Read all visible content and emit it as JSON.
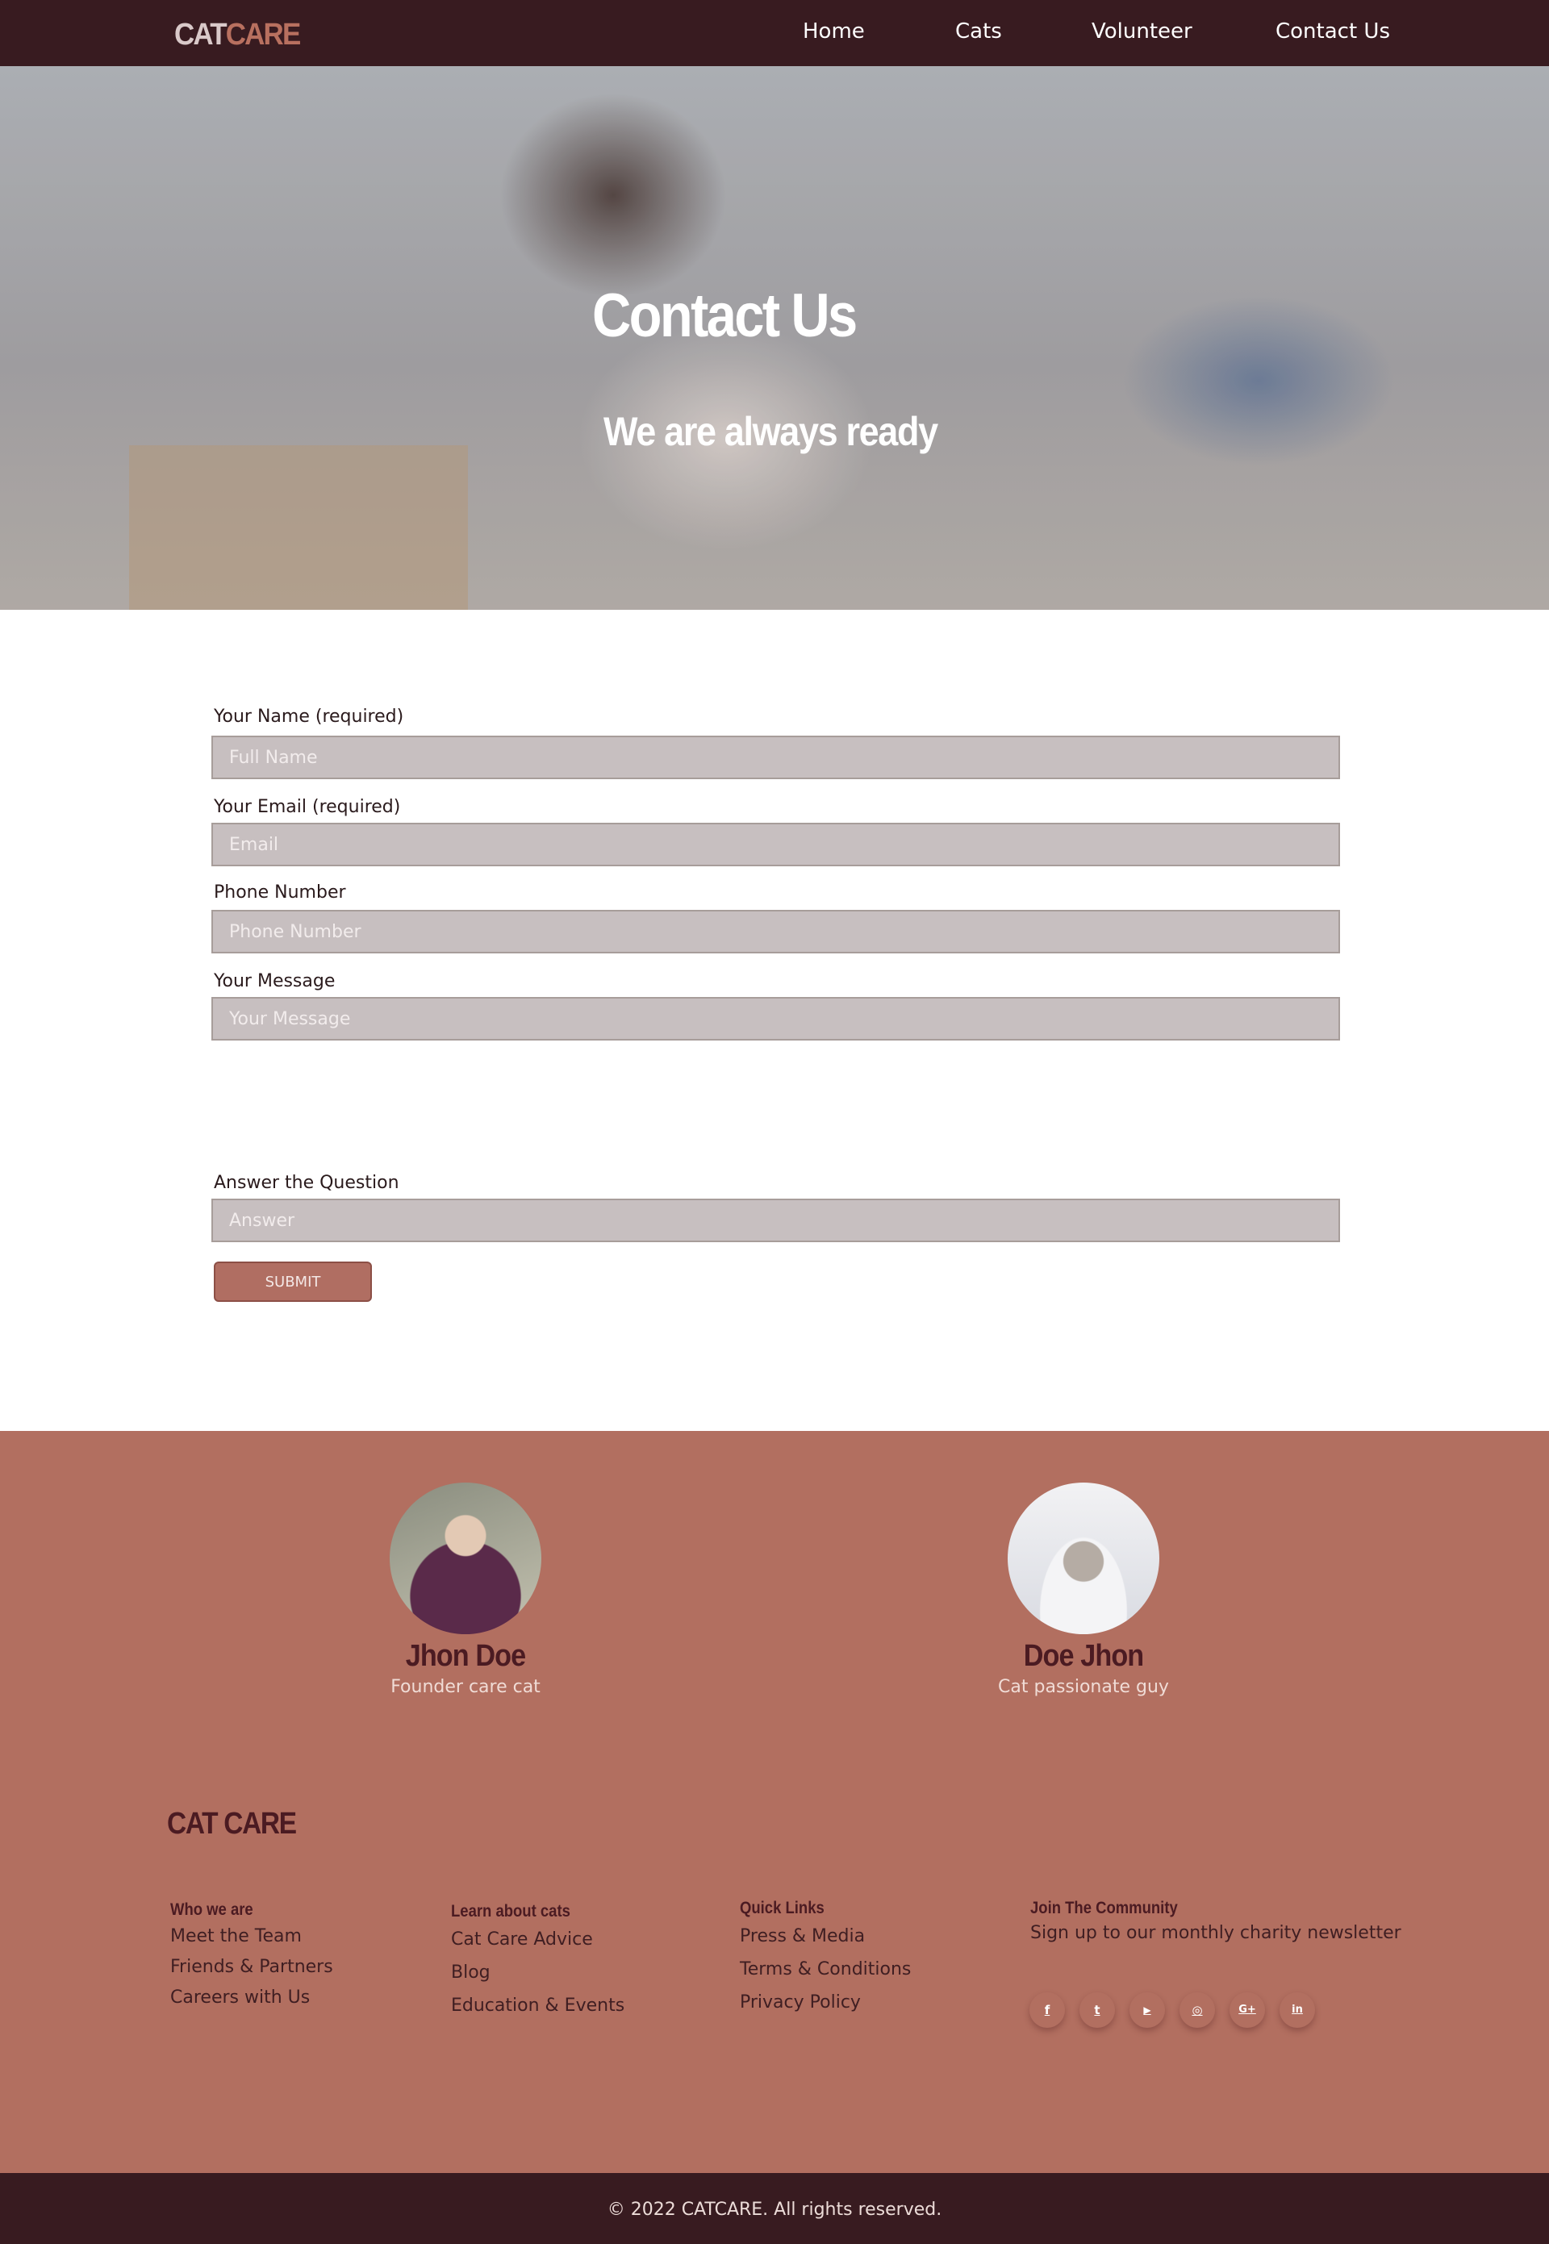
{
  "header": {
    "brand_part1": "CAT",
    "brand_part2": "CARE",
    "nav": [
      "Home",
      "Cats",
      "Volunteer",
      "Contact Us"
    ]
  },
  "hero": {
    "title": "Contact Us",
    "subtitle": "We are always ready"
  },
  "form": {
    "name_label": "Your Name (required)",
    "name_placeholder": "Full Name",
    "email_label": "Your Email (required)",
    "email_placeholder": "Email",
    "phone_label": "Phone Number",
    "phone_placeholder": "Phone Number",
    "message_label": "Your Message",
    "message_placeholder": "Your Message",
    "question_label": "Answer the Question",
    "answer_placeholder": "Answer",
    "submit_label": "SUBMIT"
  },
  "team": [
    {
      "name": "Jhon Doe",
      "role": "Founder care cat"
    },
    {
      "name": "Doe Jhon",
      "role": "Cat passionate guy"
    }
  ],
  "footer": {
    "brand": "CAT CARE",
    "who": {
      "heading": "Who we are",
      "links": [
        "Meet the Team",
        "Friends & Partners",
        "Careers with Us"
      ]
    },
    "learn": {
      "heading": "Learn about cats",
      "links": [
        "Cat Care Advice",
        "Blog",
        "Education & Events"
      ]
    },
    "quick": {
      "heading": "Quick Links",
      "links": [
        "Press & Media",
        "Terms & Conditions",
        "Privacy Policy"
      ]
    },
    "community": {
      "heading": "Join The Community",
      "text": "Sign up to our monthly charity newsletter"
    },
    "social": [
      {
        "icon": "facebook-icon",
        "glyph": "f"
      },
      {
        "icon": "twitter-icon",
        "glyph": "t"
      },
      {
        "icon": "youtube-icon",
        "glyph": "▶"
      },
      {
        "icon": "instagram-icon",
        "glyph": "◎"
      },
      {
        "icon": "google-plus-icon",
        "glyph": "G+"
      },
      {
        "icon": "linkedin-icon",
        "glyph": "in"
      }
    ],
    "copyright": "© 2022 CATCARE. All rights reserved."
  },
  "colors": {
    "header_bg": "#381b20",
    "accent": "#b26f60",
    "field_bg": "#c7bfc0",
    "dark_text": "#4b1b22"
  }
}
